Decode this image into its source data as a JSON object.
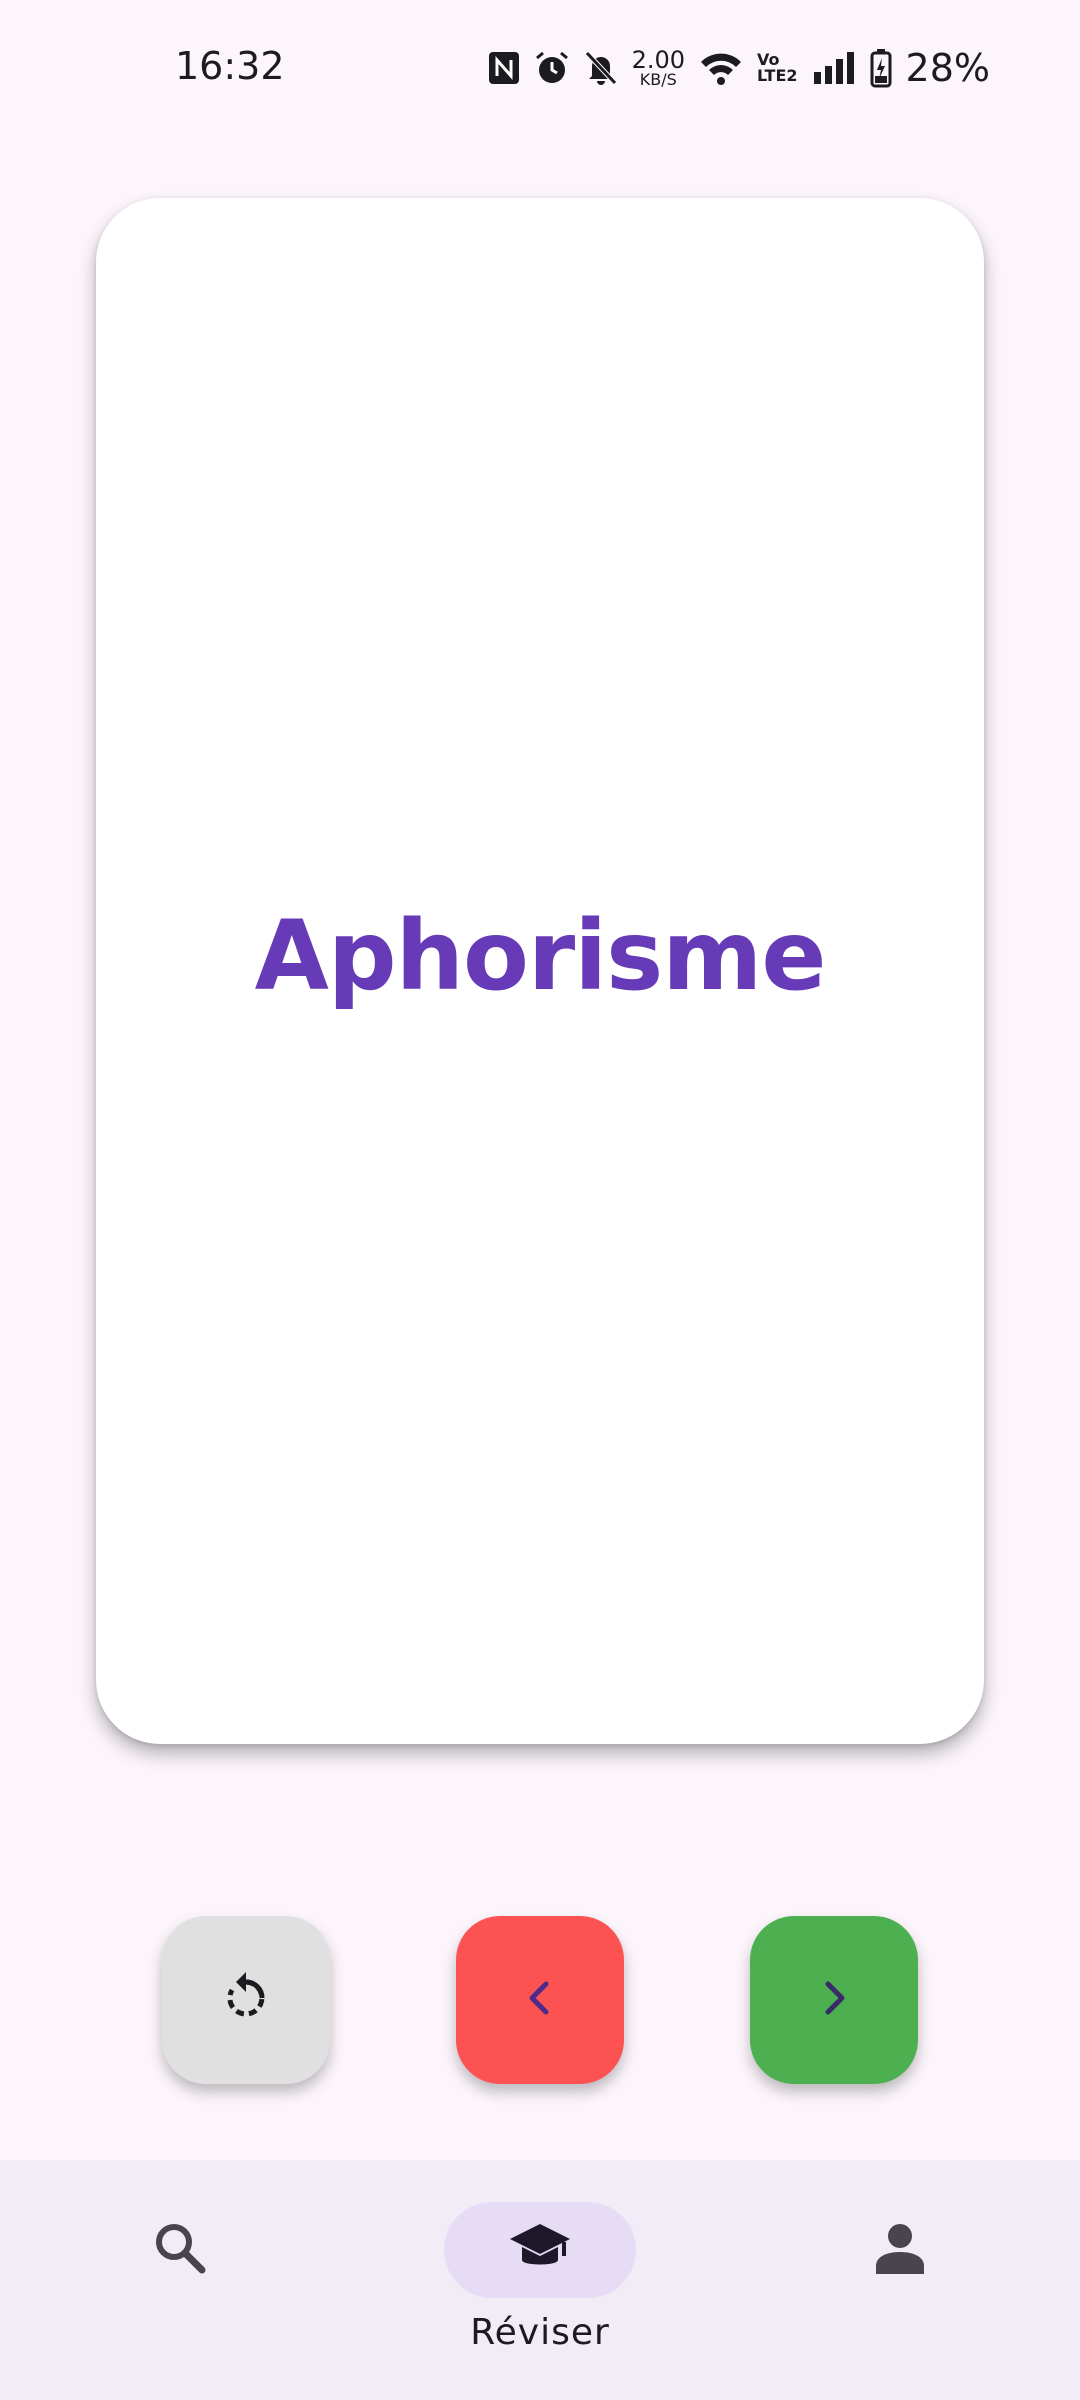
{
  "status_bar": {
    "time": "16:32",
    "net_speed_value": "2.00",
    "net_speed_unit": "KB/S",
    "volte_top": "Vo",
    "volte_bottom": "LTE2",
    "battery": "28%",
    "icons": [
      "nfc-icon",
      "alarm-icon",
      "bell-off-icon",
      "wifi-icon",
      "signal-icon",
      "battery-charging-icon"
    ]
  },
  "card": {
    "word": "Aphorisme",
    "word_color": "#673ab7"
  },
  "actions": {
    "reset_icon": "replay-icon",
    "prev_icon": "chevron-left-icon",
    "next_icon": "chevron-right-icon",
    "colors": {
      "reset": "#e0e0e0",
      "prev": "#fc5252",
      "next": "#4caf50"
    }
  },
  "bottom_nav": {
    "items": [
      {
        "icon": "search-icon",
        "label": "",
        "selected": false
      },
      {
        "icon": "graduation-cap-icon",
        "label": "Réviser",
        "selected": true
      },
      {
        "icon": "person-icon",
        "label": "",
        "selected": false
      }
    ],
    "indicator_color": "#e7dcf5"
  }
}
